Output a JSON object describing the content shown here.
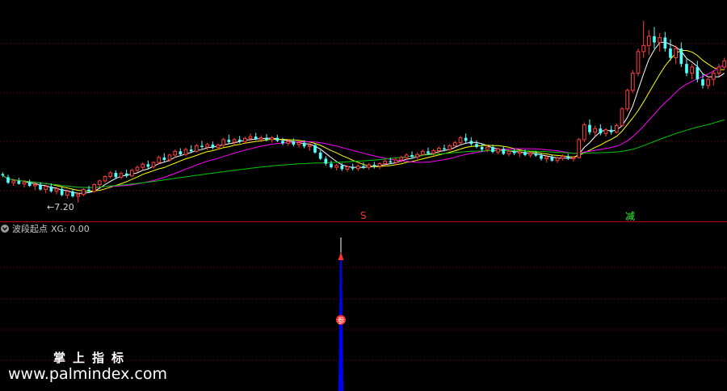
{
  "indicator": {
    "name": "波段起点",
    "value_text": "XG: 0.00"
  },
  "signals": {
    "buy_label": "S",
    "sell_label": "减",
    "marker_label": "参"
  },
  "low_price_label": "7.20",
  "watermark": {
    "title": "掌上指标",
    "url": "www.palmindex.com"
  },
  "colors": {
    "background": "#000000",
    "up_candle": "#ff3c3c",
    "down_candle": "#54ffff",
    "ma_white": "#ffffff",
    "ma_yellow": "#ffff00",
    "ma_magenta": "#ff00ff",
    "ma_green": "#00c800",
    "separator": "#c00000",
    "grid": "#8b0000",
    "signal_bar": "#0000ff",
    "buy_signal": "#ff3030",
    "sell_signal": "#22ff22"
  },
  "chart_data": {
    "type": "candlestick",
    "price_range": [
      6.9,
      13.2
    ],
    "candles": [
      [
        8.12,
        8.18,
        8.02,
        8.08
      ],
      [
        8.02,
        8.1,
        7.8,
        7.84
      ],
      [
        7.84,
        7.96,
        7.74,
        7.9
      ],
      [
        7.9,
        8.0,
        7.78,
        7.8
      ],
      [
        7.8,
        7.92,
        7.68,
        7.86
      ],
      [
        7.86,
        7.94,
        7.7,
        7.74
      ],
      [
        7.74,
        7.84,
        7.6,
        7.78
      ],
      [
        7.78,
        7.86,
        7.58,
        7.62
      ],
      [
        7.62,
        7.76,
        7.5,
        7.72
      ],
      [
        7.72,
        7.82,
        7.52,
        7.56
      ],
      [
        7.56,
        7.7,
        7.46,
        7.64
      ],
      [
        7.64,
        7.7,
        7.4,
        7.44
      ],
      [
        7.44,
        7.6,
        7.32,
        7.56
      ],
      [
        7.56,
        7.64,
        7.36,
        7.4
      ],
      [
        7.4,
        7.52,
        7.2,
        7.46
      ],
      [
        7.46,
        7.66,
        7.4,
        7.62
      ],
      [
        7.62,
        7.74,
        7.5,
        7.56
      ],
      [
        7.56,
        7.82,
        7.52,
        7.78
      ],
      [
        7.78,
        7.94,
        7.7,
        7.9
      ],
      [
        7.9,
        8.08,
        7.84,
        8.04
      ],
      [
        8.04,
        8.22,
        7.98,
        8.16
      ],
      [
        8.16,
        8.24,
        7.96,
        8.02
      ],
      [
        8.02,
        8.2,
        7.96,
        8.14
      ],
      [
        8.14,
        8.26,
        8.0,
        8.06
      ],
      [
        8.06,
        8.3,
        8.02,
        8.24
      ],
      [
        8.24,
        8.4,
        8.18,
        8.34
      ],
      [
        8.34,
        8.5,
        8.26,
        8.44
      ],
      [
        8.44,
        8.56,
        8.3,
        8.36
      ],
      [
        8.36,
        8.54,
        8.3,
        8.5
      ],
      [
        8.5,
        8.72,
        8.44,
        8.66
      ],
      [
        8.66,
        8.8,
        8.52,
        8.58
      ],
      [
        8.58,
        8.78,
        8.52,
        8.74
      ],
      [
        8.74,
        8.92,
        8.66,
        8.86
      ],
      [
        8.86,
        8.96,
        8.7,
        8.76
      ],
      [
        8.76,
        8.98,
        8.7,
        8.92
      ],
      [
        8.92,
        9.06,
        8.8,
        8.86
      ],
      [
        8.86,
        9.1,
        8.82,
        9.04
      ],
      [
        9.04,
        9.2,
        8.94,
        9.0
      ],
      [
        9.0,
        9.14,
        8.9,
        9.08
      ],
      [
        9.08,
        9.18,
        8.92,
        8.98
      ],
      [
        8.98,
        9.12,
        8.9,
        9.06
      ],
      [
        9.06,
        9.3,
        9.0,
        9.24
      ],
      [
        9.24,
        9.4,
        9.1,
        9.16
      ],
      [
        9.16,
        9.3,
        9.06,
        9.24
      ],
      [
        9.24,
        9.36,
        9.12,
        9.18
      ],
      [
        9.18,
        9.34,
        9.1,
        9.28
      ],
      [
        9.28,
        9.44,
        9.2,
        9.34
      ],
      [
        9.34,
        9.46,
        9.22,
        9.26
      ],
      [
        9.26,
        9.38,
        9.16,
        9.3
      ],
      [
        9.3,
        9.42,
        9.18,
        9.24
      ],
      [
        9.24,
        9.36,
        9.14,
        9.3
      ],
      [
        9.3,
        9.4,
        9.16,
        9.2
      ],
      [
        9.2,
        9.3,
        9.06,
        9.12
      ],
      [
        9.12,
        9.26,
        9.04,
        9.18
      ],
      [
        9.18,
        9.28,
        9.02,
        9.08
      ],
      [
        9.08,
        9.2,
        8.98,
        9.14
      ],
      [
        9.14,
        9.22,
        8.96,
        9.02
      ],
      [
        9.02,
        9.12,
        8.88,
        9.06
      ],
      [
        9.06,
        9.1,
        8.78,
        8.82
      ],
      [
        8.82,
        8.9,
        8.58,
        8.62
      ],
      [
        8.62,
        8.7,
        8.4,
        8.46
      ],
      [
        8.46,
        8.56,
        8.3,
        8.34
      ],
      [
        8.34,
        8.46,
        8.24,
        8.4
      ],
      [
        8.4,
        8.48,
        8.22,
        8.28
      ],
      [
        8.28,
        8.4,
        8.2,
        8.36
      ],
      [
        8.36,
        8.46,
        8.24,
        8.3
      ],
      [
        8.3,
        8.44,
        8.22,
        8.38
      ],
      [
        8.38,
        8.5,
        8.28,
        8.34
      ],
      [
        8.34,
        8.48,
        8.26,
        8.42
      ],
      [
        8.42,
        8.52,
        8.3,
        8.38
      ],
      [
        8.38,
        8.5,
        8.28,
        8.46
      ],
      [
        8.46,
        8.6,
        8.38,
        8.54
      ],
      [
        8.54,
        8.66,
        8.44,
        8.5
      ],
      [
        8.5,
        8.64,
        8.42,
        8.58
      ],
      [
        8.58,
        8.72,
        8.5,
        8.66
      ],
      [
        8.66,
        8.8,
        8.58,
        8.74
      ],
      [
        8.74,
        8.86,
        8.62,
        8.68
      ],
      [
        8.68,
        8.82,
        8.6,
        8.76
      ],
      [
        8.76,
        8.92,
        8.7,
        8.86
      ],
      [
        8.86,
        8.98,
        8.74,
        8.8
      ],
      [
        8.8,
        8.94,
        8.72,
        8.88
      ],
      [
        8.88,
        9.02,
        8.8,
        8.96
      ],
      [
        8.96,
        9.08,
        8.86,
        8.92
      ],
      [
        8.92,
        9.1,
        8.88,
        9.04
      ],
      [
        9.04,
        9.2,
        8.98,
        9.14
      ],
      [
        9.14,
        9.36,
        9.08,
        9.3
      ],
      [
        9.3,
        9.44,
        9.12,
        9.2
      ],
      [
        9.2,
        9.32,
        9.04,
        9.1
      ],
      [
        9.1,
        9.22,
        8.96,
        9.0
      ],
      [
        9.0,
        9.12,
        8.86,
        8.92
      ],
      [
        8.92,
        9.06,
        8.84,
        9.0
      ],
      [
        9.0,
        9.08,
        8.8,
        8.84
      ],
      [
        8.84,
        8.98,
        8.76,
        8.94
      ],
      [
        8.94,
        9.02,
        8.74,
        8.78
      ],
      [
        8.78,
        8.92,
        8.7,
        8.86
      ],
      [
        8.86,
        8.96,
        8.74,
        8.8
      ],
      [
        8.8,
        8.9,
        8.68,
        8.84
      ],
      [
        8.84,
        8.92,
        8.7,
        8.74
      ],
      [
        8.74,
        8.86,
        8.66,
        8.8
      ],
      [
        8.8,
        8.88,
        8.68,
        8.72
      ],
      [
        8.72,
        8.82,
        8.56,
        8.62
      ],
      [
        8.62,
        8.74,
        8.5,
        8.68
      ],
      [
        8.68,
        8.76,
        8.52,
        8.56
      ],
      [
        8.56,
        8.7,
        8.48,
        8.64
      ],
      [
        8.64,
        8.76,
        8.56,
        8.7
      ],
      [
        8.7,
        8.78,
        8.58,
        8.62
      ],
      [
        8.62,
        8.7,
        8.52,
        8.66
      ],
      [
        8.66,
        9.3,
        8.62,
        9.24
      ],
      [
        9.24,
        9.8,
        9.16,
        9.72
      ],
      [
        9.72,
        9.9,
        9.4,
        9.48
      ],
      [
        9.48,
        9.7,
        9.36,
        9.6
      ],
      [
        9.6,
        9.74,
        9.38,
        9.44
      ],
      [
        9.44,
        9.62,
        9.34,
        9.56
      ],
      [
        9.56,
        9.7,
        9.4,
        9.48
      ],
      [
        9.48,
        9.76,
        9.44,
        9.7
      ],
      [
        9.7,
        10.3,
        9.66,
        10.24
      ],
      [
        10.24,
        10.9,
        10.16,
        10.84
      ],
      [
        10.84,
        11.5,
        10.76,
        11.4
      ],
      [
        11.4,
        12.2,
        11.3,
        12.1
      ],
      [
        12.1,
        13.1,
        11.9,
        12.3
      ],
      [
        12.3,
        12.8,
        12.0,
        12.6
      ],
      [
        12.6,
        12.9,
        12.2,
        12.4
      ],
      [
        12.4,
        12.7,
        12.1,
        12.56
      ],
      [
        12.56,
        12.74,
        12.1,
        12.2
      ],
      [
        12.2,
        12.5,
        11.8,
        11.9
      ],
      [
        11.9,
        12.3,
        11.7,
        12.2
      ],
      [
        12.2,
        12.4,
        11.6,
        11.7
      ],
      [
        11.7,
        11.9,
        11.3,
        11.4
      ],
      [
        11.4,
        11.7,
        11.2,
        11.6
      ],
      [
        11.6,
        11.8,
        11.1,
        11.2
      ],
      [
        11.2,
        11.4,
        10.9,
        11.0
      ],
      [
        11.0,
        11.3,
        10.88,
        11.2
      ],
      [
        11.2,
        11.5,
        11.0,
        11.4
      ],
      [
        11.4,
        11.7,
        11.3,
        11.6
      ],
      [
        11.6,
        11.9,
        11.5,
        11.8
      ]
    ]
  }
}
